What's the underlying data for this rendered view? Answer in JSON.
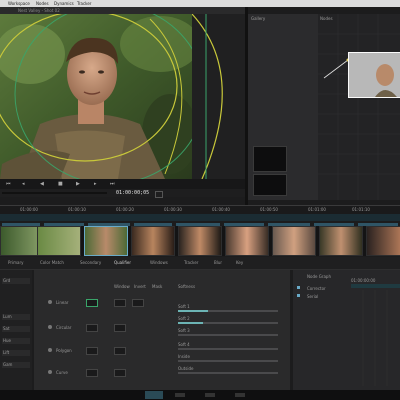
{
  "menubar": {
    "items": [
      "Workspace",
      "Nodes",
      "Dynamics",
      "Tracker"
    ]
  },
  "viewer": {
    "title": "Nest Valley - Shot 02",
    "timecode": "01:00:00;05"
  },
  "gallery": {
    "label": "Gallery"
  },
  "nodes": {
    "label": "Nodes"
  },
  "timeline": {
    "ruler_labels": [
      "01:00:00",
      "01:00:10",
      "01:00:20",
      "01:00:30",
      "01:00:40",
      "01:00:50",
      "01:01:00",
      "01:01:10"
    ]
  },
  "tabs": [
    "Primary",
    "Color Match",
    "Secondary",
    "Qualifier",
    "Windows",
    "Tracker",
    "Blur",
    "Key"
  ],
  "left_panel": {
    "rows": [
      "Grd",
      "Lum",
      "Sat",
      "Hue",
      "Lift",
      "Gam"
    ]
  },
  "center_panel": {
    "column_headers": [
      "Window",
      "Invert",
      "Mask"
    ],
    "windows": [
      "Linear",
      "Circular",
      "Polygon",
      "Curve"
    ],
    "softness_header": "Softness",
    "slider_labels": [
      "Soft 1",
      "Soft 2",
      "Soft 3",
      "Soft 4",
      "Inside",
      "Outside"
    ]
  },
  "right_panel": {
    "header": "Node Graph",
    "items": [
      "01:00:00:00",
      "Corrector",
      "Serial"
    ]
  },
  "colors": {
    "accent": "#69aac8",
    "window_circle": "#c8c83a",
    "window_green": "#3aa56a"
  }
}
